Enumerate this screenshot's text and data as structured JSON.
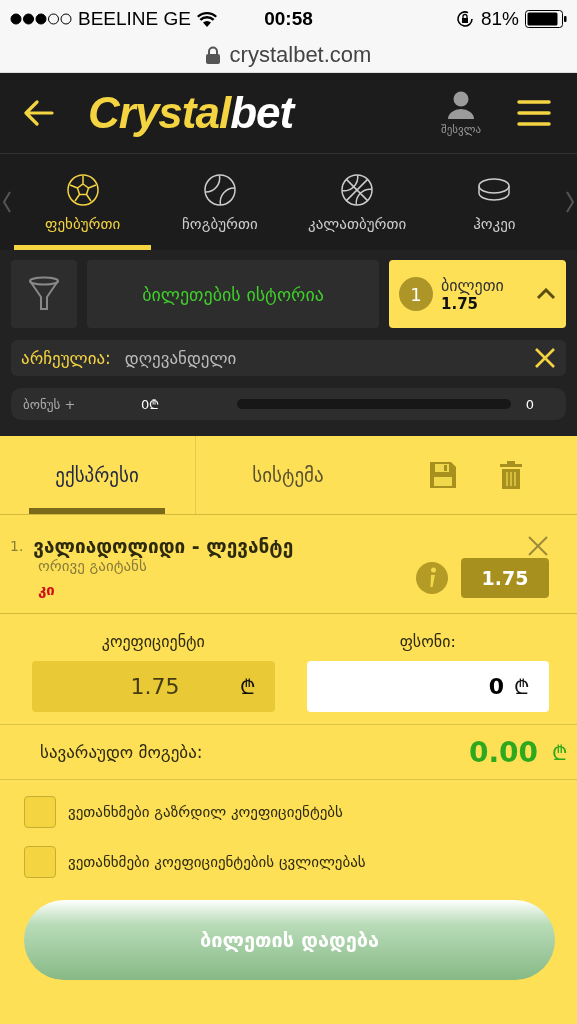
{
  "status_bar": {
    "carrier": "BEELINE GE",
    "time": "00:58",
    "battery": "81%"
  },
  "browser": {
    "url": "crystalbet.com"
  },
  "header": {
    "logo_main": "Crystal",
    "logo_accent": "bet",
    "login_label": "შესვლა"
  },
  "sports": [
    {
      "kind": "football",
      "label": "ფეხბურთი",
      "selected": true
    },
    {
      "kind": "tennis",
      "label": "ჩოგბურთი",
      "selected": false
    },
    {
      "kind": "basketball",
      "label": "კალათბურთი",
      "selected": false
    },
    {
      "kind": "hockey",
      "label": "ჰოკეი",
      "selected": false
    }
  ],
  "toolbar": {
    "history_button": "ბილეთების ისტორია",
    "ticket_count": "1",
    "ticket_label": "ბილეთი",
    "ticket_odds": "1.75"
  },
  "filter": {
    "label": "არჩეულია:",
    "value": "დღევანდელი"
  },
  "bonus": {
    "label": "ბონუს +",
    "amount": "0₾",
    "count": "0",
    "level": 0
  },
  "betslip_tabs": [
    {
      "label": "ექსპრესი",
      "selected": true
    },
    {
      "label": "სისტემა",
      "selected": false
    }
  ],
  "bets": [
    {
      "number": "1.",
      "match": "ვალიადოლიდი - ლევანტე",
      "market": "ორივე გაიტანს",
      "selection": "კი",
      "odds": "1.75"
    }
  ],
  "stake": {
    "odds_label": "კოეფიციენტი",
    "odds_value": "1.75",
    "odds_currency": "₾",
    "stake_label": "ფსონი:",
    "stake_value": "0",
    "stake_currency": "₾",
    "win_label": "სავარაუდო მოგება:",
    "win_value": "0.00",
    "win_currency": "₾"
  },
  "agreements": [
    {
      "label": "ვეთანხმები გაზრდილ კოეფიციენტებს",
      "checked": false
    },
    {
      "label": "ვეთანხმები კოეფიციენტების ცვლილებას",
      "checked": false
    }
  ],
  "place_button": "ბილეთის დადება"
}
